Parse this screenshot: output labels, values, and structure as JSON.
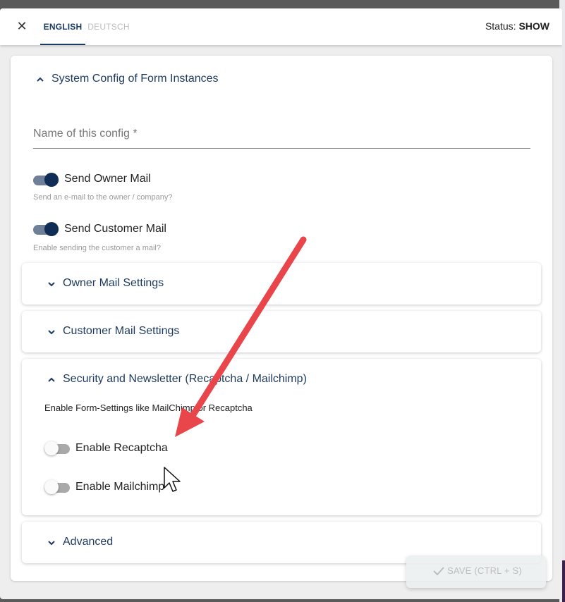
{
  "header": {
    "close_glyph": "✕",
    "tabs": [
      {
        "label": "ENGLISH",
        "active": true
      },
      {
        "label": "DEUTSCH",
        "active": false
      }
    ],
    "status_label": "Status:",
    "status_value": "SHOW"
  },
  "config": {
    "section_title": "System Config of Form Instances",
    "name_placeholder": "Name of this config *",
    "name_value": "",
    "owner_mail": {
      "label": "Send Owner Mail",
      "hint": "Send an e-mail to the owner / company?",
      "enabled": true
    },
    "customer_mail": {
      "label": "Send Customer Mail",
      "hint": "Enable sending the customer a mail?",
      "enabled": true
    }
  },
  "panels": [
    {
      "title": "Owner Mail Settings",
      "expanded": false
    },
    {
      "title": "Customer Mail Settings",
      "expanded": false
    },
    {
      "title": "Security and Newsletter (Recaptcha / Mailchimp)",
      "expanded": true,
      "description": "Enable Form-Settings like MailChimp or Recaptcha",
      "toggles": [
        {
          "label": "Enable Recaptcha",
          "enabled": false
        },
        {
          "label": "Enable Mailchimp",
          "enabled": false
        }
      ]
    },
    {
      "title": "Advanced",
      "expanded": false
    }
  ],
  "footer": {
    "save_label": "SAVE (CTRL + S)",
    "save_icon": "check-icon"
  },
  "colors": {
    "accent": "#0f2d55",
    "heading": "#1e3a5f",
    "annotation_arrow": "#e8464a"
  }
}
